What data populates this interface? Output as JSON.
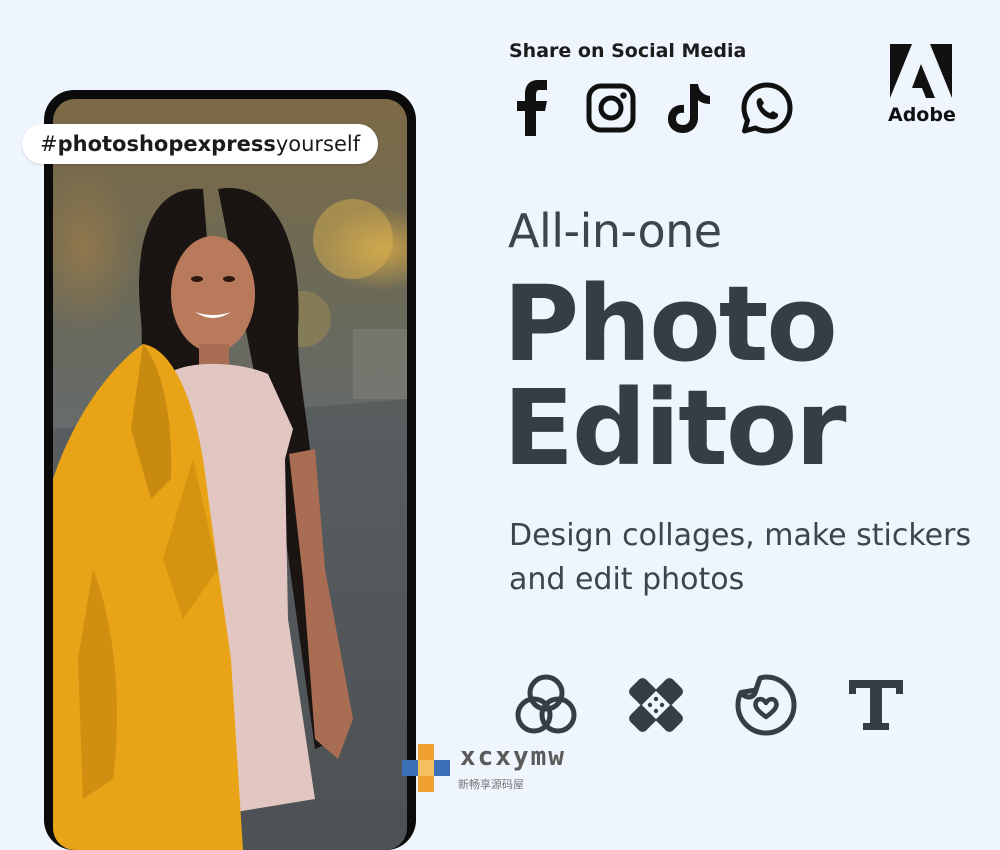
{
  "hashtag": {
    "prefix": "#",
    "bold": "photoshopexpress",
    "rest": "yourself"
  },
  "social": {
    "title": "Share on Social Media",
    "icons": [
      "facebook-icon",
      "instagram-icon",
      "tiktok-icon",
      "whatsapp-icon"
    ]
  },
  "brand": {
    "name": "Adobe",
    "logo": "adobe-logo-icon"
  },
  "hero": {
    "tagline": "All-in-one",
    "title_line1": "Photo",
    "title_line2": "Editor",
    "description": "Design collages, make stickers and edit photos"
  },
  "features": [
    "blend-circles-icon",
    "bandage-healing-icon",
    "sticker-icon",
    "text-tool-icon"
  ],
  "watermark": {
    "name": "xcxymw",
    "sub": "新畅享源码屋"
  },
  "colors": {
    "background": "#eef5fc",
    "text_dark": "#343e44",
    "jacket_yellow": "#e8a317",
    "watermark_orange": "#f0a030",
    "watermark_blue": "#3b6fb6"
  }
}
